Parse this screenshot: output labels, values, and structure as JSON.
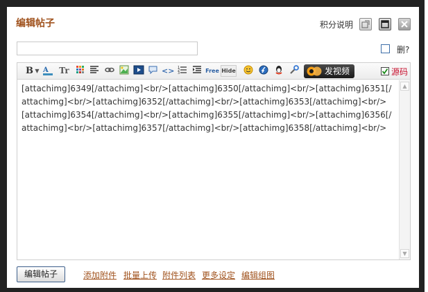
{
  "dialog": {
    "title": "编辑帖子",
    "score_link": "积分说明"
  },
  "subject": {
    "value": "",
    "placeholder": ""
  },
  "delete_option": {
    "label": "删?",
    "checked": false
  },
  "toolbar": {
    "bold_label": "B",
    "size_label": "Tr",
    "free_label": "Free",
    "hide_label": "Hide",
    "video_label": "发视频",
    "source_label": "源码",
    "source_checked": true
  },
  "content": "[attachimg]6349[/attachimg]<br/>[attachimg]6350[/attachimg]<br/>[attachimg]6351[/attachimg]<br/>[attachimg]6352[/attachimg]<br/>[attachimg]6353[/attachimg]<br/>[attachimg]6354[/attachimg]<br/>[attachimg]6355[/attachimg]<br/>[attachimg]6356[/attachimg]<br/>[attachimg]6357[/attachimg]<br/>[attachimg]6358[/attachimg]<br/>",
  "footer": {
    "submit_label": "编辑帖子",
    "links": {
      "add_attachment": "添加附件",
      "batch_upload": "批量上传",
      "attachment_list": "附件列表",
      "more_settings": "更多设定",
      "edit_group": "编辑组图"
    }
  },
  "colors": {
    "title": "#a0521d",
    "link": "#a0521d",
    "source_label": "#c8102e",
    "frame": "#222222"
  }
}
